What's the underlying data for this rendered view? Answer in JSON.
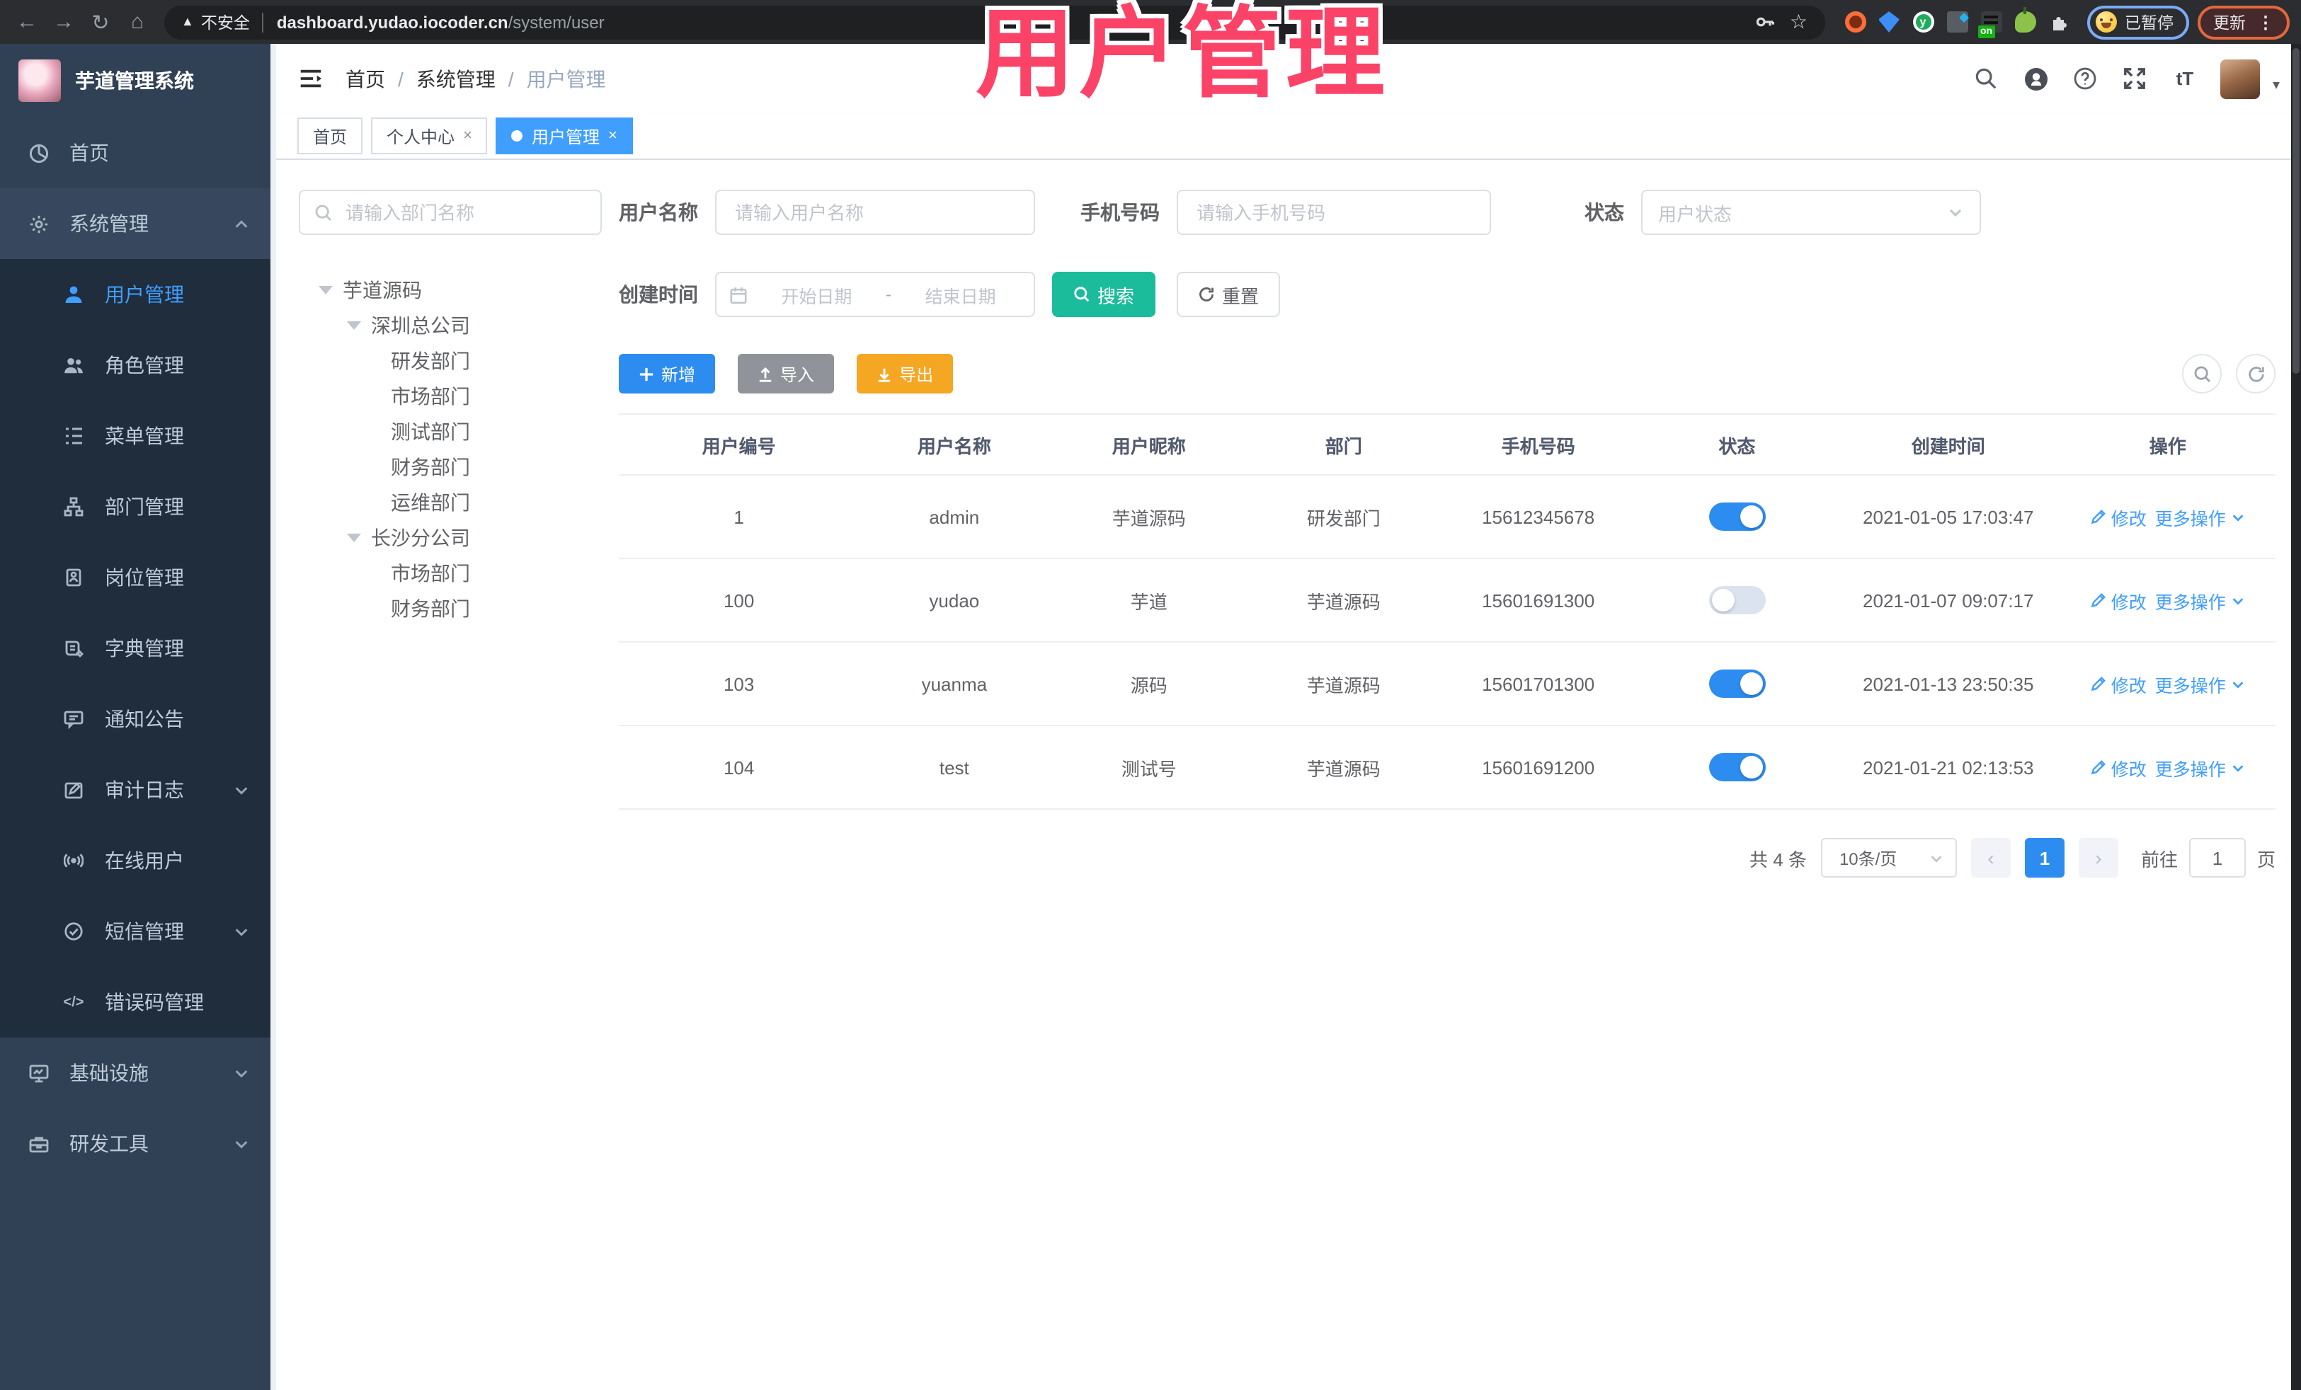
{
  "glyphs": {
    "back": "←",
    "forward": "→",
    "reload": "↻",
    "home": "⌂",
    "warning_triangle": "▲",
    "star": "☆",
    "kebab": "⋮",
    "slash": "/",
    "help": "?",
    "font_size": "tT",
    "caret_down": "▾",
    "close": "×",
    "prev": "‹",
    "next": "›",
    "code": "</>",
    "ext_y_letter": "y"
  },
  "browser": {
    "not_secure_label": "不安全",
    "url_host": "dashboard.yudao.iocoder.cn",
    "url_path": "/system/user",
    "extension_on_badge": "on",
    "paused_label": "已暂停",
    "update_label": "更新"
  },
  "colors": {
    "accent_blue": "#409eff",
    "button_blue": "#2d8cf0",
    "search_teal": "#1abc9c",
    "export_orange": "#f5a623",
    "import_gray": "#909399",
    "overlay_pink": "#fb4368",
    "sidebar_bg": "#304156",
    "submenu_bg": "#1f2d3d",
    "switch_on": "#2d8cf0"
  },
  "app": {
    "title": "芋道管理系统",
    "overlay_title": "用户管理",
    "breadcrumb": [
      "首页",
      "系统管理",
      "用户管理"
    ]
  },
  "sidebar": {
    "items": [
      {
        "label": "首页"
      },
      {
        "label": "系统管理",
        "children": [
          {
            "label": "用户管理"
          },
          {
            "label": "角色管理"
          },
          {
            "label": "菜单管理"
          },
          {
            "label": "部门管理"
          },
          {
            "label": "岗位管理"
          },
          {
            "label": "字典管理"
          },
          {
            "label": "通知公告"
          },
          {
            "label": "审计日志"
          },
          {
            "label": "在线用户"
          },
          {
            "label": "短信管理"
          },
          {
            "label": "错误码管理"
          }
        ]
      },
      {
        "label": "基础设施"
      },
      {
        "label": "研发工具"
      }
    ]
  },
  "tabs": [
    {
      "label": "首页"
    },
    {
      "label": "个人中心"
    },
    {
      "label": "用户管理"
    }
  ],
  "tree": {
    "search_placeholder": "请输入部门名称",
    "nodes": [
      "芋道源码",
      "深圳总公司",
      "研发部门",
      "市场部门",
      "测试部门",
      "财务部门",
      "运维部门",
      "长沙分公司",
      "市场部门",
      "财务部门"
    ]
  },
  "filters": {
    "username_label": "用户名称",
    "username_placeholder": "请输入用户名称",
    "mobile_label": "手机号码",
    "mobile_placeholder": "请输入手机号码",
    "status_label": "状态",
    "status_placeholder": "用户状态",
    "create_time_label": "创建时间",
    "date_start_placeholder": "开始日期",
    "date_separator": "-",
    "date_end_placeholder": "结束日期",
    "search_label": "搜索",
    "reset_label": "重置"
  },
  "toolbar": {
    "add_label": "新增",
    "import_label": "导入",
    "export_label": "导出"
  },
  "table": {
    "headers": [
      "用户编号",
      "用户名称",
      "用户昵称",
      "部门",
      "手机号码",
      "状态",
      "创建时间",
      "操作"
    ],
    "rows": [
      {
        "id": "1",
        "username": "admin",
        "nickname": "芋道源码",
        "dept": "研发部门",
        "mobile": "15612345678",
        "status": "on",
        "create_time": "2021-01-05 17:03:47"
      },
      {
        "id": "100",
        "username": "yudao",
        "nickname": "芋道",
        "dept": "芋道源码",
        "mobile": "15601691300",
        "status": "off",
        "create_time": "2021-01-07 09:07:17"
      },
      {
        "id": "103",
        "username": "yuanma",
        "nickname": "源码",
        "dept": "芋道源码",
        "mobile": "15601701300",
        "status": "on",
        "create_time": "2021-01-13 23:50:35"
      },
      {
        "id": "104",
        "username": "test",
        "nickname": "测试号",
        "dept": "芋道源码",
        "mobile": "15601691200",
        "status": "on",
        "create_time": "2021-01-21 02:13:53"
      }
    ],
    "edit_label": "修改",
    "more_label": "更多操作"
  },
  "pagination": {
    "total_label": "共 4 条",
    "page_size_label": "10条/页",
    "current_page": "1",
    "goto_label": "前往",
    "goto_value": "1",
    "page_unit_label": "页"
  }
}
